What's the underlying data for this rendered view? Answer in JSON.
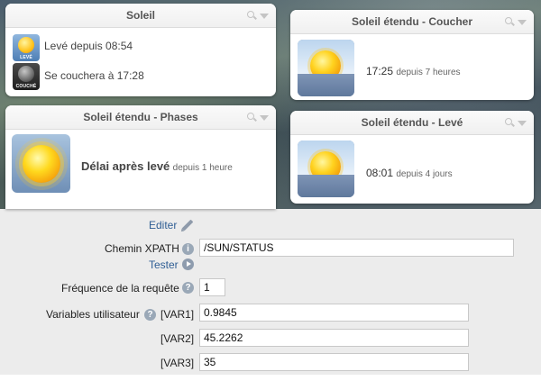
{
  "widgets": {
    "soleil": {
      "title": "Soleil",
      "leve_icon_caption": "LEVÉ",
      "couche_icon_caption": "COUCHÉ",
      "line1": "Levé depuis 08:54",
      "line2": "Se couchera à 17:28"
    },
    "coucher": {
      "title": "Soleil étendu - Coucher",
      "time": "17:25",
      "ago": "depuis 7 heures"
    },
    "phases": {
      "title": "Soleil étendu - Phases",
      "status": "Délai après levé",
      "ago": "depuis 1 heure"
    },
    "leve": {
      "title": "Soleil étendu - Levé",
      "time": "08:01",
      "ago": "depuis 4 jours"
    }
  },
  "form": {
    "edit_link": "Editer",
    "xpath_label": "Chemin XPATH",
    "xpath_value": "/SUN/STATUS",
    "test_link": "Tester",
    "freq_label": "Fréquence de la requête",
    "freq_value": "1",
    "vars_label": "Variables utilisateur",
    "vars": [
      {
        "name": "[VAR1]",
        "value": "0.9845"
      },
      {
        "name": "[VAR2]",
        "value": "45.2262"
      },
      {
        "name": "[VAR3]",
        "value": "35"
      }
    ]
  },
  "icons": {
    "help": "help-icon",
    "info": "info-icon",
    "play": "play-icon",
    "edit": "pencil-icon",
    "search": "search-icon",
    "menu": "chevron-down-icon"
  },
  "colors": {
    "link": "#2f5e94",
    "form_bg": "#ececec",
    "help_icon": "#9aa8b7"
  }
}
